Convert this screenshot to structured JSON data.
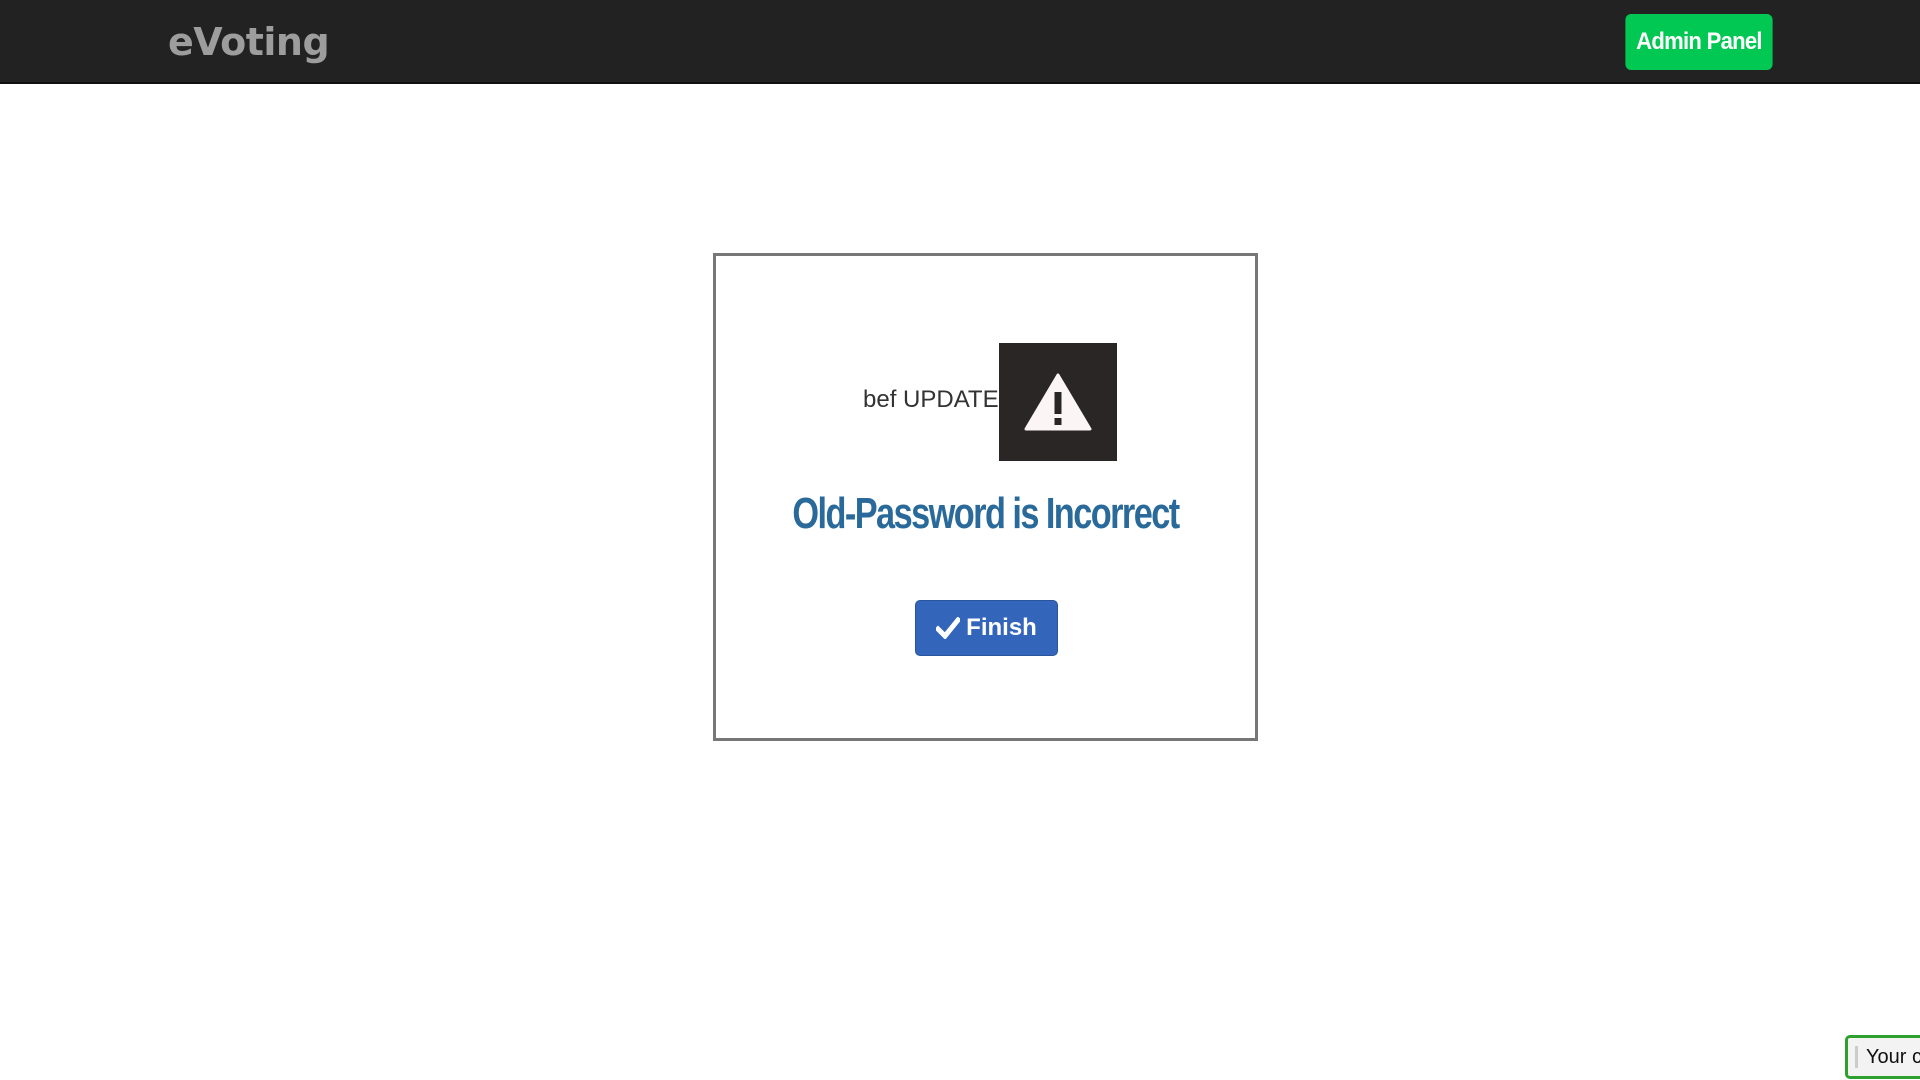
{
  "navbar": {
    "brand": "eVoting",
    "admin_button": "Admin Panel"
  },
  "card": {
    "status_text": "bef UPDATE",
    "status_icon": "warning-triangle-icon",
    "message": "Old-Password is Incorrect",
    "finish_button": "Finish",
    "finish_icon": "check-icon"
  },
  "cookie_notice": {
    "text": "Your c"
  },
  "colors": {
    "navbar_bg": "#222222",
    "brand_text": "#9d9d9d",
    "admin_button_bg": "#00c853",
    "message_text": "#2a6a9a",
    "finish_button_bg": "#3366bb",
    "warning_box_bg": "#2b2626",
    "cookie_border": "#2ea02e"
  }
}
